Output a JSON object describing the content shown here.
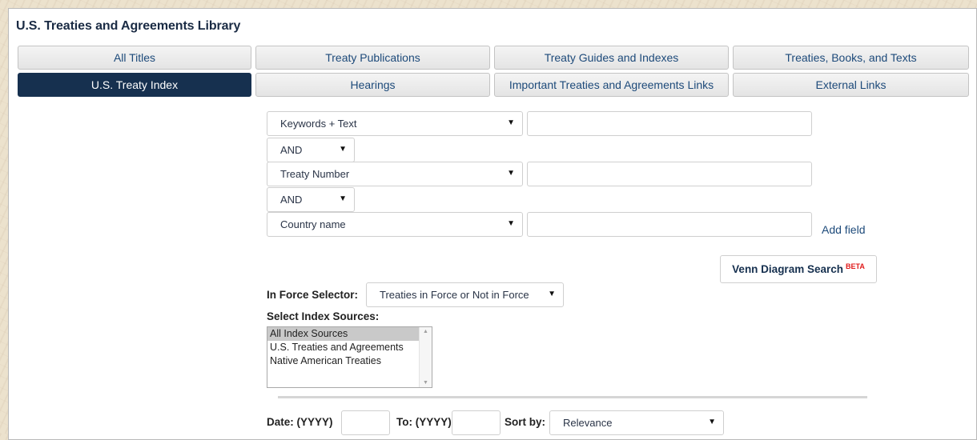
{
  "library": {
    "title": "U.S. Treaties and Agreements Library"
  },
  "tabs_row1": [
    "All Titles",
    "Treaty Publications",
    "Treaty Guides and Indexes",
    "Treaties, Books, and Texts"
  ],
  "tabs_row2": [
    "U.S. Treaty Index",
    "Hearings",
    "Important Treaties and Agreements Links",
    "External Links"
  ],
  "active_tab": "U.S. Treaty Index",
  "search": {
    "field1": {
      "selected": "Keywords + Text",
      "value": ""
    },
    "op1": "AND",
    "field2": {
      "selected": "Treaty Number",
      "value": ""
    },
    "op2": "AND",
    "field3": {
      "selected": "Country name",
      "value": ""
    },
    "add_field": "Add field"
  },
  "venn": {
    "label": "Venn Diagram Search",
    "badge": "BETA"
  },
  "in_force": {
    "label": "In Force Selector:",
    "selected": "Treaties in Force or Not in Force"
  },
  "index_sources": {
    "label": "Select Index Sources:",
    "options": [
      "All Index Sources",
      "U.S. Treaties and Agreements",
      "Native American Treaties"
    ],
    "selected": "All Index Sources"
  },
  "date": {
    "from_label": "Date: (YYYY)",
    "to_label": "To: (YYYY)",
    "from": "",
    "to": ""
  },
  "sort": {
    "label": "Sort by:",
    "selected": "Relevance"
  },
  "colors": {
    "accent": "#16304f",
    "link": "#1d4a7a",
    "beta": "#e01a1a"
  },
  "icons": {
    "dropdown": "triangle-down-icon"
  }
}
